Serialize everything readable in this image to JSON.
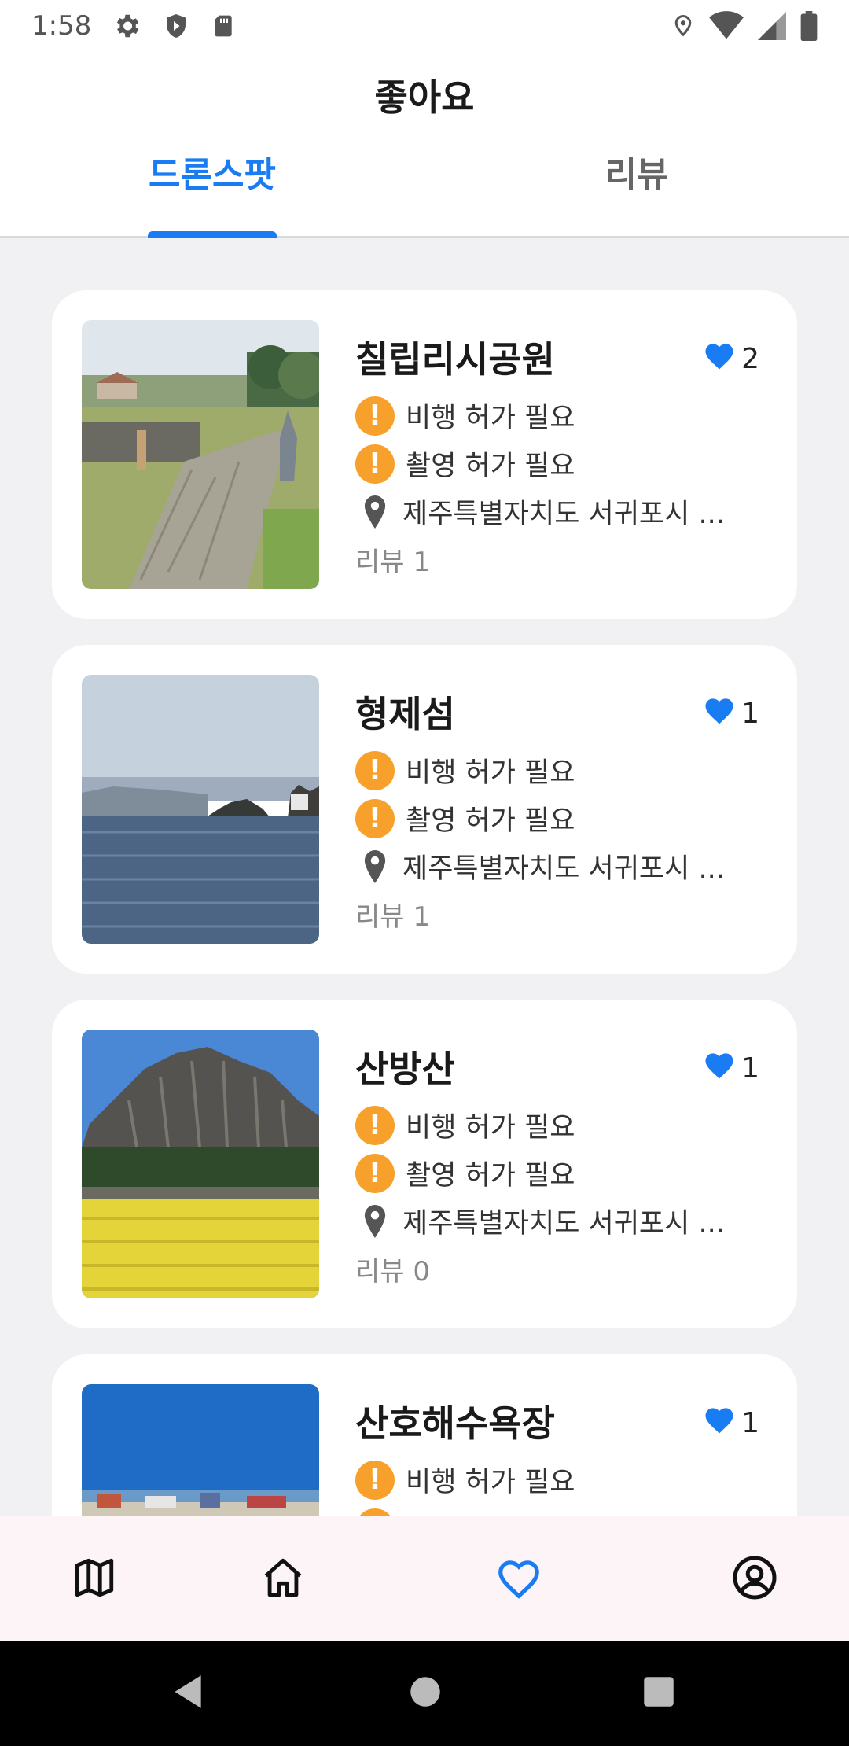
{
  "status_bar": {
    "time": "1:58"
  },
  "header": {
    "title": "좋아요",
    "tabs": [
      {
        "label": "드론스팟",
        "active": true
      },
      {
        "label": "리뷰",
        "active": false
      }
    ]
  },
  "spots": [
    {
      "name": "칠립리시공원",
      "likes": "2",
      "flight_permit": "비행 허가 필요",
      "photo_permit": "촬영 허가 필요",
      "address": "제주특별자치도 서귀포시 ...",
      "reviews": "리뷰 1",
      "image": "park-path"
    },
    {
      "name": "형제섬",
      "likes": "1",
      "flight_permit": "비행 허가 필요",
      "photo_permit": "촬영 허가 필요",
      "address": "제주특별자치도 서귀포시 ...",
      "reviews": "리뷰 1",
      "image": "sea-islands"
    },
    {
      "name": "산방산",
      "likes": "1",
      "flight_permit": "비행 허가 필요",
      "photo_permit": "촬영 허가 필요",
      "address": "제주특별자치도 서귀포시 ...",
      "reviews": "리뷰 0",
      "image": "mountain-canola"
    },
    {
      "name": "산호해수욕장",
      "likes": "1",
      "flight_permit": "비행 허가 필요",
      "photo_permit": "촬영 허가 필요",
      "image": "beach-village"
    }
  ],
  "bottom_nav": [
    {
      "icon": "map-icon",
      "active": false
    },
    {
      "icon": "home-icon",
      "active": false
    },
    {
      "icon": "heart-icon",
      "active": true
    },
    {
      "icon": "account-icon",
      "active": false
    }
  ],
  "colors": {
    "accent": "#1a7cf2",
    "warning": "#f7a12c",
    "background": "#f1f1f4"
  }
}
